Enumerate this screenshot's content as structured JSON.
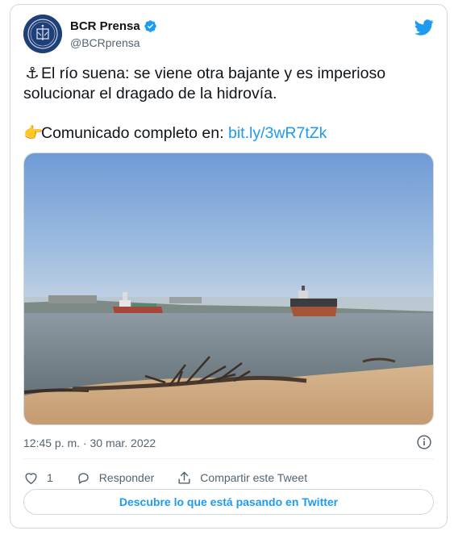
{
  "author": {
    "name": "BCR Prensa",
    "handle": "@BCRprensa",
    "verified": true
  },
  "tweet": {
    "line1_emoji": "⚓",
    "line1_text": "El río suena: se viene otra bajante y es imperioso solucionar el dragado de la hidrovía.",
    "line2_emoji": "👉",
    "line2_text": "Comunicado completo en: ",
    "link_text": "bit.ly/3wR7tZk"
  },
  "timestamp": "12:45 p. m. · 30 mar. 2022",
  "actions": {
    "like_count": "1",
    "reply_label": "Responder",
    "share_label": "Compartir este Tweet"
  },
  "cta_label": "Descubre lo que está pasando en Twitter",
  "colors": {
    "accent": "#1d9bf0",
    "secondary_text": "#536471",
    "border": "#cfd9de"
  },
  "icons": [
    "verified-badge-icon",
    "twitter-bird-icon",
    "info-icon",
    "heart-icon",
    "reply-icon",
    "share-icon"
  ]
}
